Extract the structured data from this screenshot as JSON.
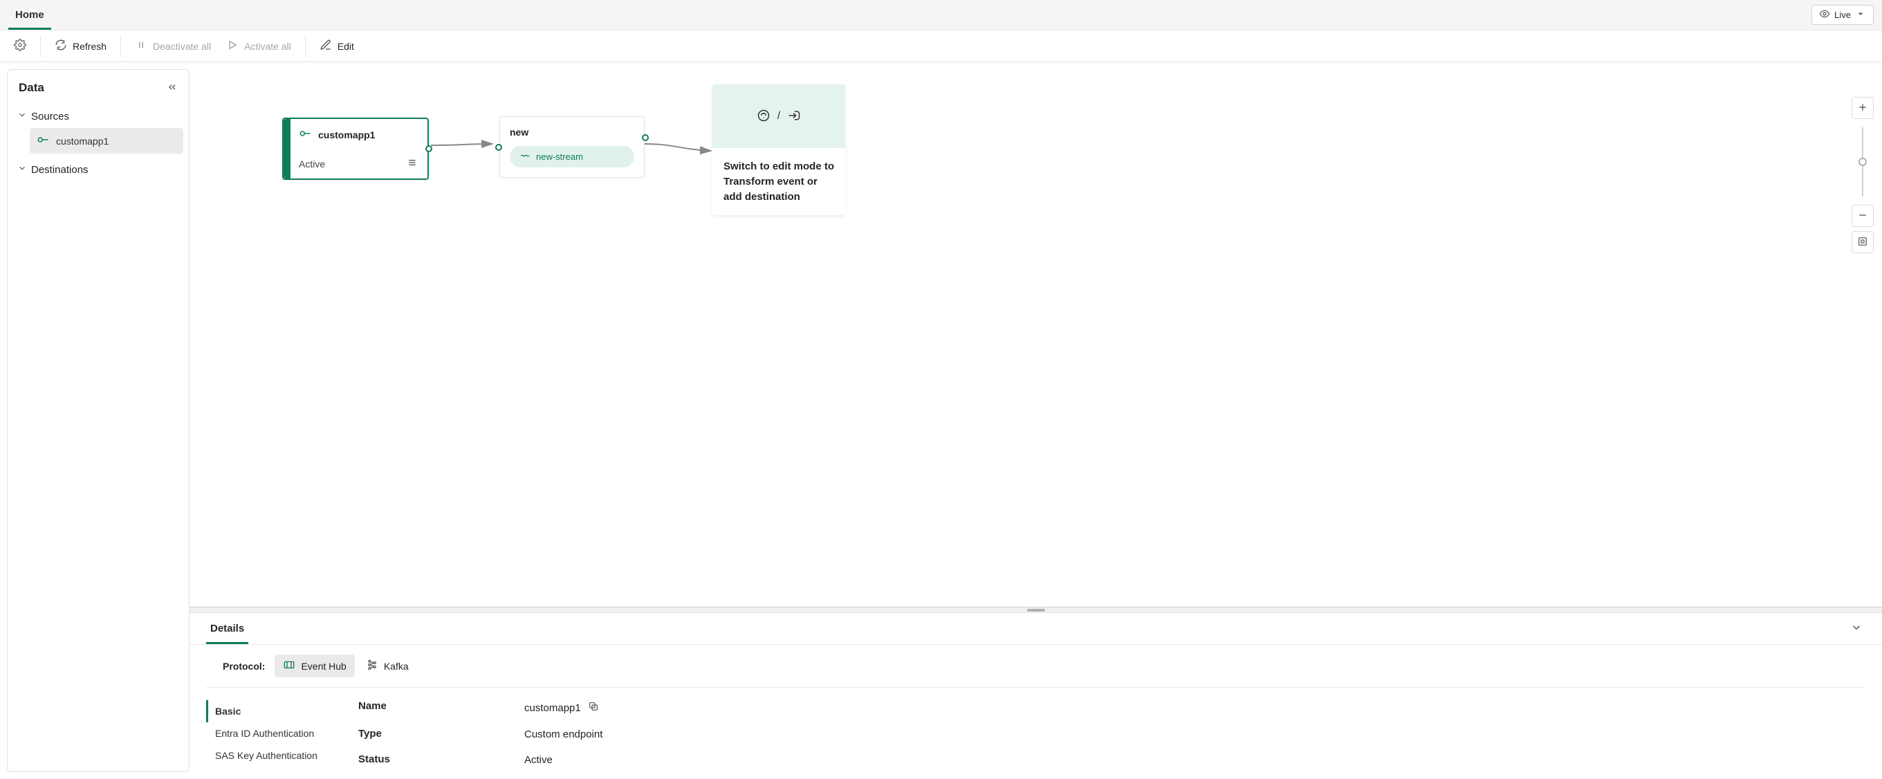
{
  "tabs": {
    "home": "Home"
  },
  "live_button": "Live",
  "toolbar": {
    "refresh": "Refresh",
    "deactivate_all": "Deactivate all",
    "activate_all": "Activate all",
    "edit": "Edit"
  },
  "side_panel": {
    "title": "Data",
    "sources_label": "Sources",
    "destinations_label": "Destinations",
    "sources": [
      {
        "label": "customapp1"
      }
    ]
  },
  "canvas": {
    "source_node": {
      "title": "customapp1",
      "status": "Active"
    },
    "stream_node": {
      "title": "new",
      "stream_name": "new-stream"
    },
    "placeholder_node": {
      "text": "Switch to edit mode to Transform event or add destination",
      "separator": "/"
    }
  },
  "details": {
    "tab_label": "Details",
    "protocol_label": "Protocol:",
    "protocols": {
      "eventhub": "Event Hub",
      "kafka": "Kafka"
    },
    "sidebar": {
      "basic": "Basic",
      "entra": "Entra ID Authentication",
      "sas": "SAS Key Authentication"
    },
    "fields": {
      "name_label": "Name",
      "name_value": "customapp1",
      "type_label": "Type",
      "type_value": "Custom endpoint",
      "status_label": "Status",
      "status_value": "Active"
    }
  }
}
